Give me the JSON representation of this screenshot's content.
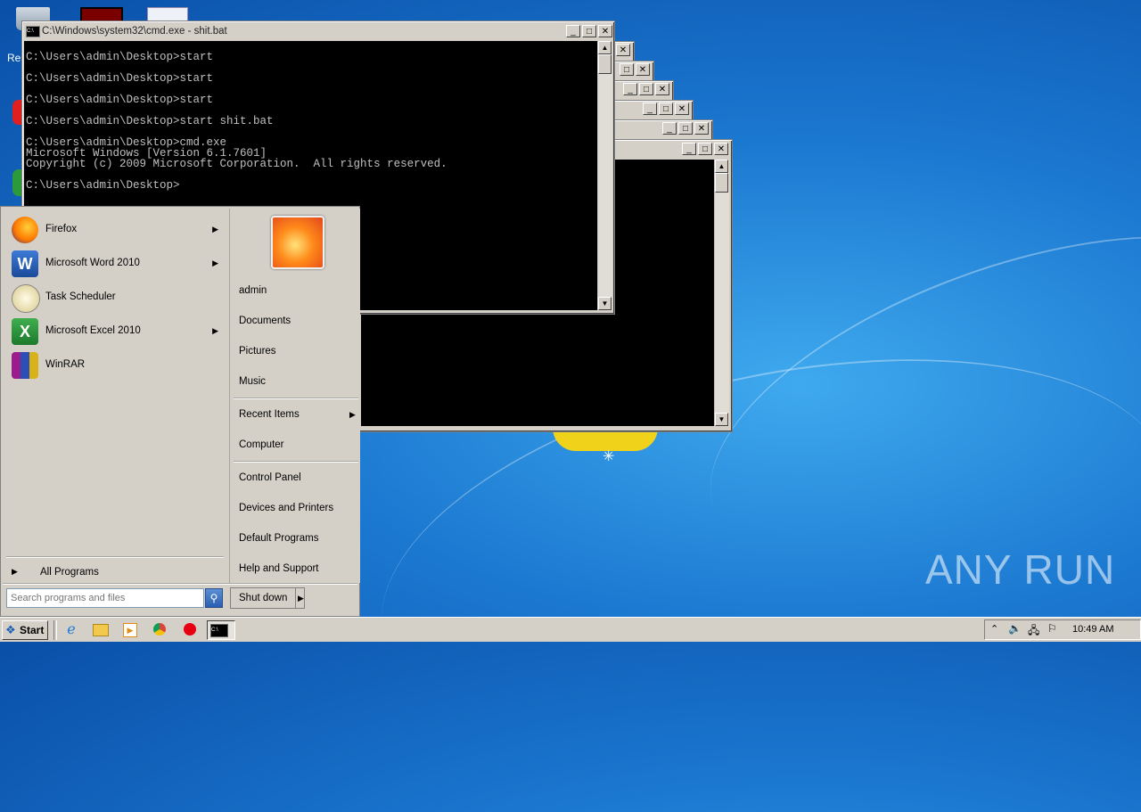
{
  "desktop": {
    "partial_icon_label": "Re",
    "watermark": "ANY RUN"
  },
  "cmd_window": {
    "title": "C:\\Windows\\system32\\cmd.exe - shit.bat",
    "lines": [
      "",
      "C:\\Users\\admin\\Desktop>start",
      "",
      "C:\\Users\\admin\\Desktop>start",
      "",
      "C:\\Users\\admin\\Desktop>start",
      "",
      "C:\\Users\\admin\\Desktop>start shit.bat",
      "",
      "C:\\Users\\admin\\Desktop>cmd.exe",
      "Microsoft Windows [Version 6.1.7601]",
      "Copyright (c) 2009 Microsoft Corporation.  All rights reserved.",
      "",
      "C:\\Users\\admin\\Desktop>"
    ]
  },
  "start_menu": {
    "programs": [
      {
        "label": "Firefox",
        "icon": "firefox-icon",
        "submenu": true
      },
      {
        "label": "Microsoft Word 2010",
        "icon": "word-icon",
        "submenu": true
      },
      {
        "label": "Task Scheduler",
        "icon": "task-scheduler-icon",
        "submenu": false
      },
      {
        "label": "Microsoft Excel 2010",
        "icon": "excel-icon",
        "submenu": true
      },
      {
        "label": "WinRAR",
        "icon": "winrar-icon",
        "submenu": false
      }
    ],
    "all_programs": "All Programs",
    "search_placeholder": "Search programs and files",
    "right_items": {
      "user": "admin",
      "documents": "Documents",
      "pictures": "Pictures",
      "music": "Music",
      "recent_items": "Recent Items",
      "computer": "Computer",
      "control_panel": "Control Panel",
      "devices_printers": "Devices and Printers",
      "default_programs": "Default Programs",
      "help_support": "Help and Support"
    },
    "shutdown": "Shut down"
  },
  "taskbar": {
    "start_label": "Start",
    "clock": "10:49 AM",
    "pinned": [
      "ie-icon",
      "explorer-icon",
      "media-player-icon",
      "chrome-icon",
      "opera-icon",
      "cmd-icon"
    ]
  }
}
